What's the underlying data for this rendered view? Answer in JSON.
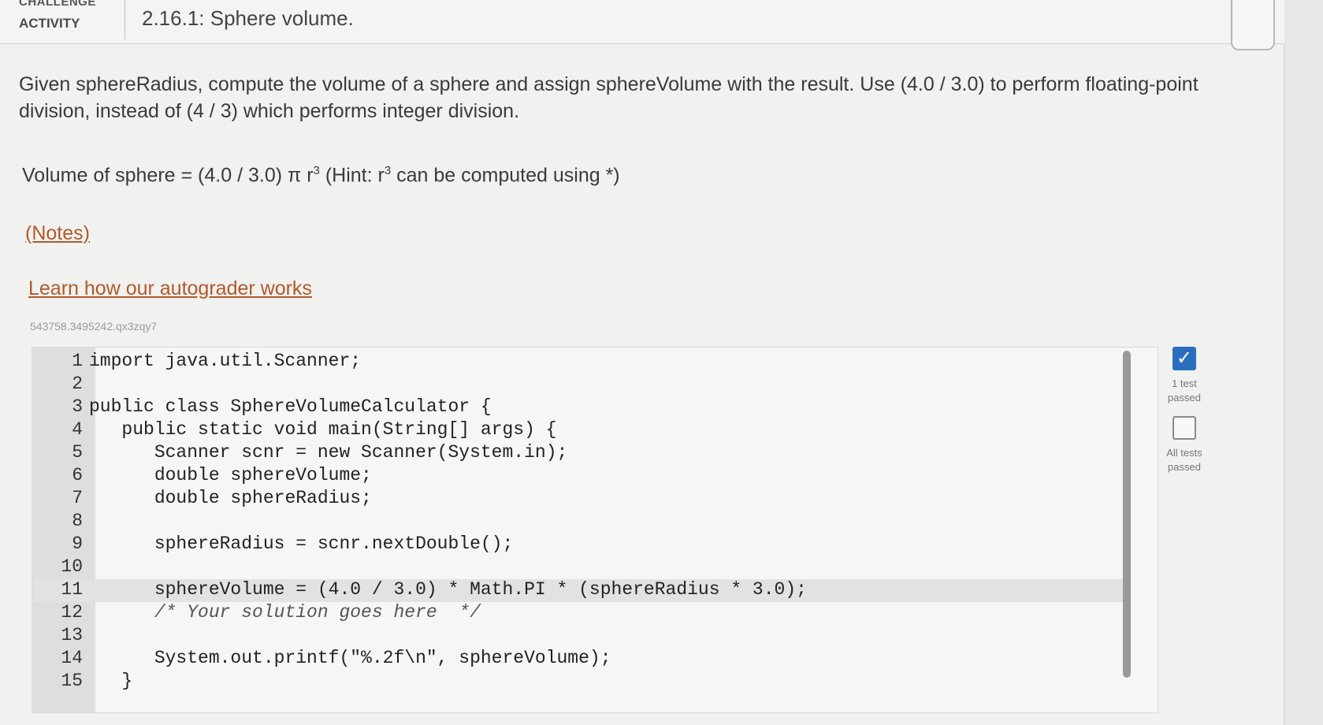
{
  "header": {
    "challenge_label": "CHALLENGE",
    "activity_label": "ACTIVITY",
    "title": "2.16.1: Sphere volume."
  },
  "instructions": {
    "paragraph": "Given sphereRadius, compute the volume of a sphere and assign sphereVolume with the result. Use (4.0 / 3.0) to perform floating-point division, instead of (4 / 3) which performs integer division.",
    "formula_prefix": "Volume of sphere = (4.0 / 3.0) π r",
    "formula_sup": "3",
    "formula_hint_prefix": " (Hint: r",
    "formula_hint_sup": "3",
    "formula_hint_suffix": " can be computed using *)",
    "notes_link": "(Notes)",
    "autograder_link": "Learn how our autograder works"
  },
  "code_id": "543758.3495242.qx3zqy7",
  "code_lines": [
    {
      "num": "1",
      "text": "import java.util.Scanner;"
    },
    {
      "num": "2",
      "text": ""
    },
    {
      "num": "3",
      "text": "public class SphereVolumeCalculator {"
    },
    {
      "num": "4",
      "text": "   public static void main(String[] args) {"
    },
    {
      "num": "5",
      "text": "      Scanner scnr = new Scanner(System.in);"
    },
    {
      "num": "6",
      "text": "      double sphereVolume;"
    },
    {
      "num": "7",
      "text": "      double sphereRadius;"
    },
    {
      "num": "8",
      "text": ""
    },
    {
      "num": "9",
      "text": "      sphereRadius = scnr.nextDouble();"
    },
    {
      "num": "10",
      "text": ""
    },
    {
      "num": "11",
      "text": "      sphereVolume = (4.0 / 3.0) * Math.PI * (sphereRadius * 3.0);"
    },
    {
      "num": "12",
      "text": "      /* Your solution goes here  */"
    },
    {
      "num": "13",
      "text": ""
    },
    {
      "num": "14",
      "text": "      System.out.printf(\"%.2f\\n\", sphereVolume);"
    },
    {
      "num": "15",
      "text": "   }"
    }
  ],
  "tests": {
    "first_label_line1": "1 test",
    "first_label_line2": "passed",
    "second_label_line1": "All tests",
    "second_label_line2": "passed",
    "check_glyph": "✓"
  },
  "icons": {
    "test_passed": "check-icon",
    "all_tests": "empty-checkbox-icon"
  },
  "colors": {
    "link": "#b05a2a",
    "check": "#2a6fbf"
  }
}
